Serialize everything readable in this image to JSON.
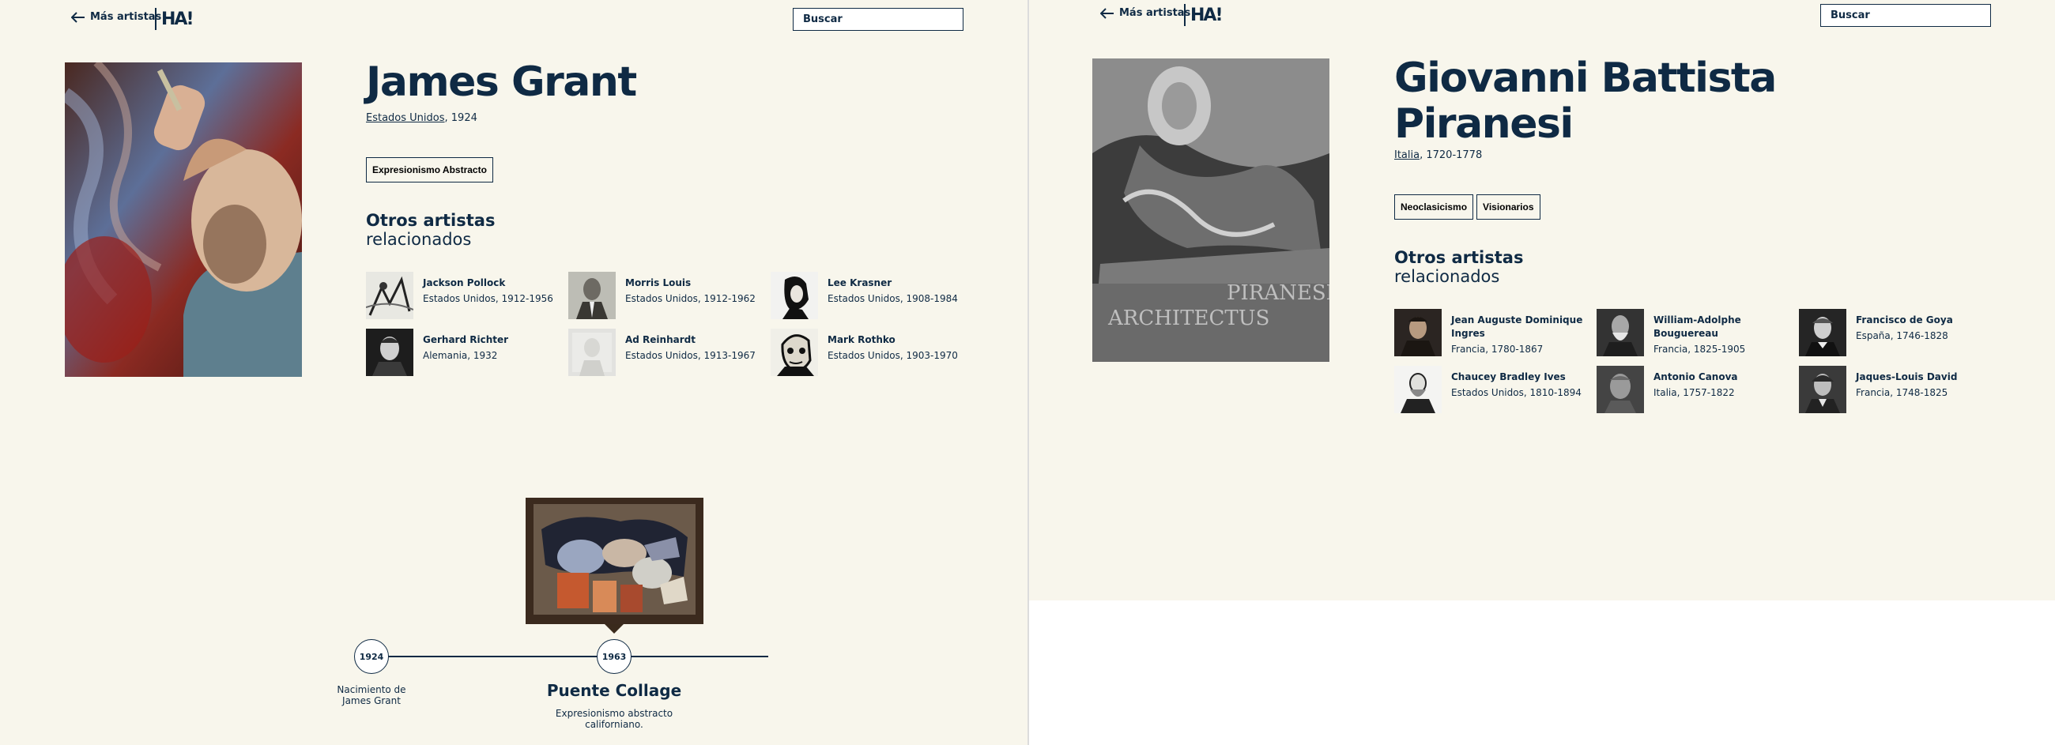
{
  "pages": [
    {
      "header": {
        "back_label": "Más artistas",
        "logo_text": "HA!",
        "search_label": "Buscar"
      },
      "artist": {
        "name": "James Grant",
        "country": "Estados Unidos",
        "dates": ", 1924"
      },
      "movements": [
        "Expresionismo Abstracto"
      ],
      "related": {
        "heading_line1": "Otros artistas",
        "heading_line2": "relacionados",
        "items": [
          {
            "name": "Jackson Pollock",
            "meta": "Estados Unidos, 1912-1956"
          },
          {
            "name": "Morris Louis",
            "meta": "Estados Unidos, 1912-1962"
          },
          {
            "name": "Lee Krasner",
            "meta": "Estados Unidos, 1908-1984"
          },
          {
            "name": "Gerhard Richter",
            "meta": "Alemania, 1932"
          },
          {
            "name": "Ad Reinhardt",
            "meta": "Estados Unidos, 1913-1967"
          },
          {
            "name": "Mark Rothko",
            "meta": "Estados Unidos, 1903-1970"
          }
        ]
      },
      "timeline": {
        "events": [
          {
            "year": "1924",
            "label_line1": "Nacimiento de",
            "label_line2": "James Grant"
          },
          {
            "year": "1963",
            "title": "Puente Collage",
            "desc_line1": "Expresionismo abstracto",
            "desc_line2": "californiano."
          }
        ]
      }
    },
    {
      "header": {
        "back_label": "Más artistas",
        "logo_text": "HA!",
        "search_label": "Buscar"
      },
      "artist": {
        "name_line1": "Giovanni Battista",
        "name_line2": "Piranesi",
        "country": "Italia",
        "dates": ", 1720-1778"
      },
      "movements": [
        "Neoclasicismo",
        "Visionarios"
      ],
      "related": {
        "heading_line1": "Otros artistas",
        "heading_line2": "relacionados",
        "items": [
          {
            "name_line1": "Jean Auguste Dominique",
            "name_line2": "Ingres",
            "meta": "Francia, 1780-1867"
          },
          {
            "name_line1": "William-Adolphe",
            "name_line2": "Bouguereau",
            "meta": "Francia, 1825-1905"
          },
          {
            "name_line1": "Francisco de Goya",
            "name_line2": "",
            "meta": "España, 1746-1828"
          },
          {
            "name_line1": "Chaucey Bradley Ives",
            "name_line2": "",
            "meta": "Estados Unidos, 1810-1894"
          },
          {
            "name_line1": "Antonio Canova",
            "name_line2": "",
            "meta": "Italia, 1757-1822"
          },
          {
            "name_line1": "Jaques-Louis David",
            "name_line2": "",
            "meta": "Francia, 1748-1825"
          }
        ]
      },
      "portrait_inscription_1": "PIRANESI",
      "portrait_inscription_2": "ARCHITECTUS"
    }
  ],
  "colors": {
    "background": "#f8f6ec",
    "ink": "#0f2a44",
    "divider": "#dcdcdc"
  }
}
